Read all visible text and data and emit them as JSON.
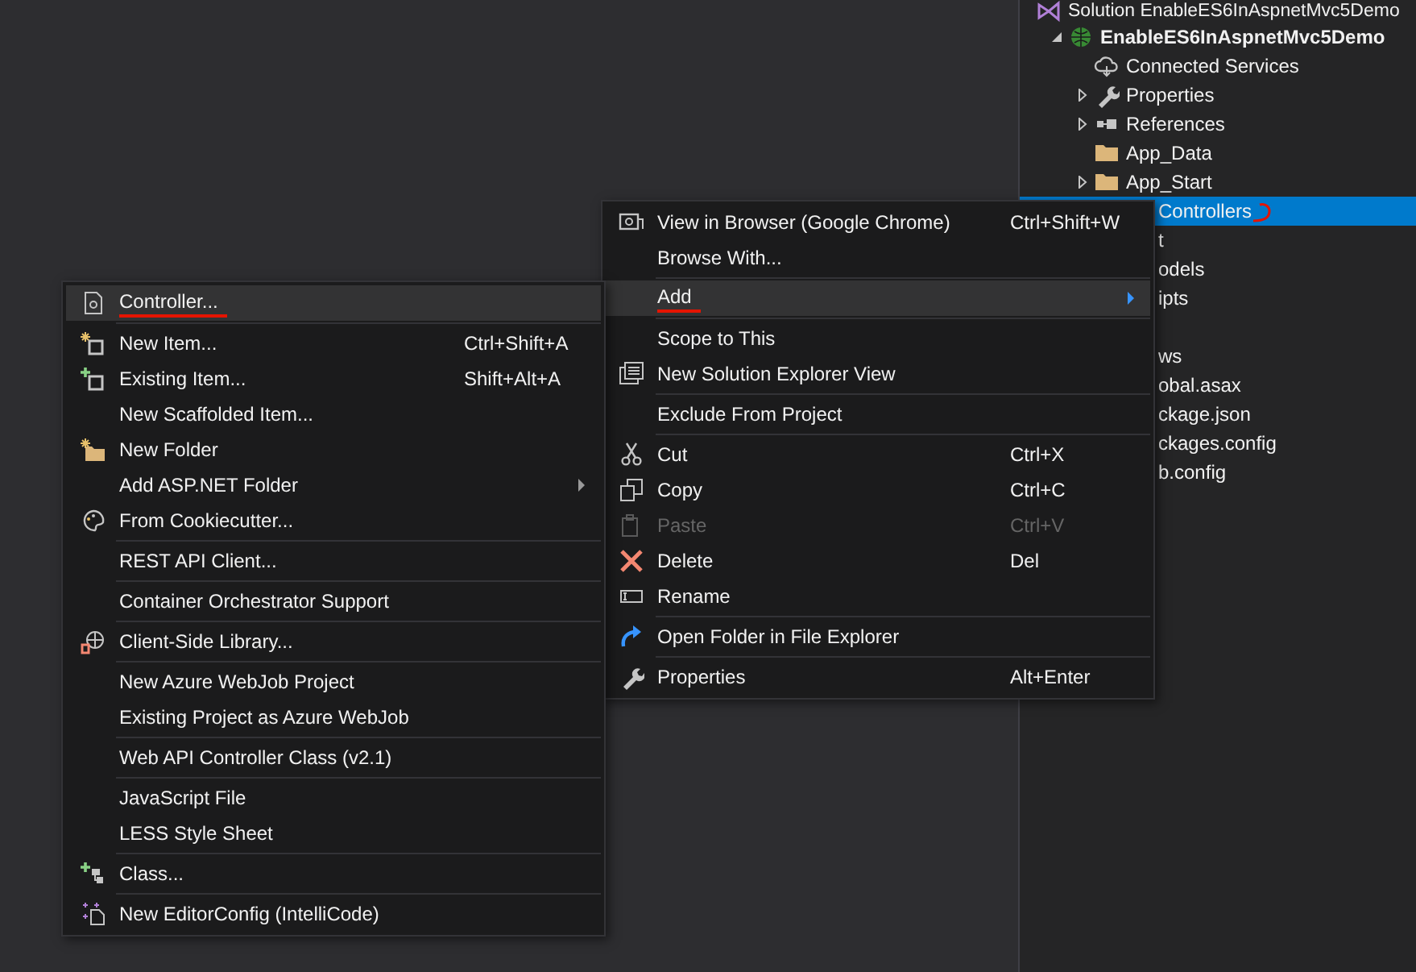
{
  "solution_explorer": {
    "tree": [
      {
        "label": "Solution EnableES6InAspnetMvc5Demo",
        "kind": "solution",
        "children": [
          {
            "label": "EnableES6InAspnetMvc5Demo",
            "kind": "project",
            "bold": true,
            "expanded": true,
            "children": [
              {
                "label": "Connected Services",
                "kind": "cloud"
              },
              {
                "label": "Properties",
                "kind": "wrench",
                "expanded": false
              },
              {
                "label": "References",
                "kind": "references",
                "expanded": false
              },
              {
                "label": "App_Data",
                "kind": "folder"
              },
              {
                "label": "App_Start",
                "kind": "folder",
                "expanded": false
              },
              {
                "label": "Controllers",
                "kind": "partial",
                "selected": true,
                "marked": true
              },
              {
                "label": "t",
                "kind": "partial",
                "selected": false,
                "marked": false
              },
              {
                "label": "odels",
                "kind": "partial",
                "selected": false,
                "marked": false
              },
              {
                "label": "ipts",
                "kind": "partial",
                "selected": false,
                "marked": false
              },
              {
                "kind": "blank"
              },
              {
                "label": "ws",
                "kind": "partial",
                "selected": false,
                "marked": false
              },
              {
                "label": "obal.asax",
                "kind": "partial",
                "selected": false,
                "marked": false
              },
              {
                "label": "ckage.json",
                "kind": "partial",
                "selected": false,
                "marked": false
              },
              {
                "label": "ckages.config",
                "kind": "partial",
                "selected": false,
                "marked": false
              },
              {
                "label": "b.config",
                "kind": "partial",
                "selected": false,
                "marked": false
              }
            ]
          }
        ]
      }
    ]
  },
  "context_menu": {
    "items": [
      {
        "kind": "browser",
        "label": "View in Browser (Google Chrome)",
        "shortcut": "Ctrl+Shift+W",
        "selected": false,
        "disabled": false
      },
      {
        "kind": "plain",
        "label": "Browse With...",
        "selected": false,
        "disabled": false
      },
      {
        "kind": "separator"
      },
      {
        "kind": "plain",
        "label": "Add",
        "submenu": true,
        "selected": true,
        "disabled": false,
        "marked": true
      },
      {
        "kind": "separator"
      },
      {
        "kind": "plain",
        "label": "Scope to This",
        "selected": false,
        "disabled": false
      },
      {
        "kind": "solution-view",
        "label": "New Solution Explorer View",
        "selected": false,
        "disabled": false
      },
      {
        "kind": "separator"
      },
      {
        "kind": "plain",
        "label": "Exclude From Project",
        "selected": false,
        "disabled": false
      },
      {
        "kind": "separator"
      },
      {
        "kind": "cut",
        "label": "Cut",
        "shortcut": "Ctrl+X",
        "selected": false,
        "disabled": false
      },
      {
        "kind": "copy",
        "label": "Copy",
        "shortcut": "Ctrl+C",
        "selected": false,
        "disabled": false
      },
      {
        "kind": "paste",
        "label": "Paste",
        "shortcut": "Ctrl+V",
        "selected": false,
        "disabled": true
      },
      {
        "kind": "delete",
        "label": "Delete",
        "shortcut": "Del",
        "selected": false,
        "disabled": false
      },
      {
        "kind": "rename",
        "label": "Rename",
        "selected": false,
        "disabled": false
      },
      {
        "kind": "separator"
      },
      {
        "kind": "open-folder",
        "label": "Open Folder in File Explorer",
        "selected": false,
        "disabled": false
      },
      {
        "kind": "separator"
      },
      {
        "kind": "wrench",
        "label": "Properties",
        "shortcut": "Alt+Enter",
        "selected": false,
        "disabled": false
      }
    ]
  },
  "add_submenu": {
    "items": [
      {
        "kind": "controller",
        "label": "Controller...",
        "selected": true,
        "disabled": false,
        "marked": true
      },
      {
        "kind": "separator"
      },
      {
        "kind": "new-item",
        "label": "New Item...",
        "shortcut": "Ctrl+Shift+A",
        "selected": false,
        "disabled": false
      },
      {
        "kind": "existing-item",
        "label": "Existing Item...",
        "shortcut": "Shift+Alt+A",
        "selected": false,
        "disabled": false
      },
      {
        "kind": "plain",
        "label": "New Scaffolded Item...",
        "selected": false,
        "disabled": false
      },
      {
        "kind": "new-folder",
        "label": "New Folder",
        "selected": false,
        "disabled": false
      },
      {
        "kind": "plain",
        "label": "Add ASP.NET Folder",
        "submenu": true,
        "selected": false,
        "disabled": false
      },
      {
        "kind": "cookiecutter",
        "label": "From Cookiecutter...",
        "selected": false,
        "disabled": false
      },
      {
        "kind": "separator"
      },
      {
        "kind": "plain",
        "label": "REST API Client...",
        "selected": false,
        "disabled": false
      },
      {
        "kind": "separator"
      },
      {
        "kind": "plain",
        "label": "Container Orchestrator Support",
        "selected": false,
        "disabled": false
      },
      {
        "kind": "separator"
      },
      {
        "kind": "client-library",
        "label": "Client-Side Library...",
        "selected": false,
        "disabled": false
      },
      {
        "kind": "separator"
      },
      {
        "kind": "plain",
        "label": "New Azure WebJob Project",
        "selected": false,
        "disabled": false
      },
      {
        "kind": "plain",
        "label": "Existing Project as Azure WebJob",
        "selected": false,
        "disabled": false
      },
      {
        "kind": "separator"
      },
      {
        "kind": "plain",
        "label": "Web API Controller Class (v2.1)",
        "selected": false,
        "disabled": false
      },
      {
        "kind": "separator"
      },
      {
        "kind": "plain",
        "label": "JavaScript File",
        "selected": false,
        "disabled": false
      },
      {
        "kind": "plain",
        "label": "LESS Style Sheet",
        "selected": false,
        "disabled": false
      },
      {
        "kind": "separator"
      },
      {
        "kind": "class",
        "label": "Class...",
        "selected": false,
        "disabled": false
      },
      {
        "kind": "separator"
      },
      {
        "kind": "editorconfig",
        "label": "New EditorConfig (IntelliCode)",
        "selected": false,
        "disabled": false
      }
    ]
  }
}
